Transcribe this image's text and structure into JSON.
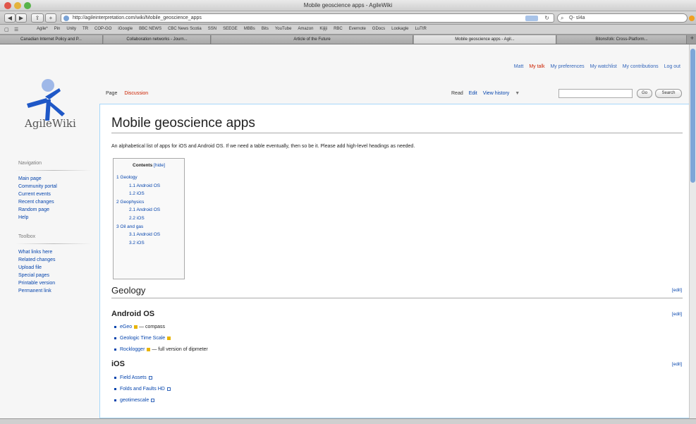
{
  "window": {
    "title": "Mobile geoscience apps - AgileWiki"
  },
  "toolbar": {
    "back": "◀",
    "forward": "▶",
    "add": "+",
    "url": "http://agileinterpretation.com/wiki/Mobile_geoscience_apps",
    "search_value": "Q- sl4a"
  },
  "bookmarks": [
    "Agile*",
    "Pin",
    "Unity",
    "TR",
    "COP-GO",
    "iGoogle",
    "BBC NEWS",
    "CBC News Scotia",
    "SSN",
    "SEEGE",
    "MBBs",
    "Bits",
    "YouTube",
    "Amazon",
    "Kijiji",
    "RBC",
    "Evernote",
    "GDocs",
    "Lookagle",
    "LuTtR"
  ],
  "tabs": [
    "Canadian Internet Policy and P...",
    "Collaboration networks - Journ...",
    "Article of the Future",
    "Mobile geoscience apps - Agil...",
    "Bitonsfolk: Cross-Platform..."
  ],
  "personal": {
    "user": "Matt",
    "talk": "My talk",
    "prefs": "My preferences",
    "watchlist": "My watchlist",
    "contribs": "My contributions",
    "logout": "Log out"
  },
  "logo_text": "AgileWiki",
  "nav": {
    "heading": "Navigation",
    "items": [
      "Main page",
      "Community portal",
      "Current events",
      "Recent changes",
      "Random page",
      "Help"
    ]
  },
  "toolbox": {
    "heading": "Toolbox",
    "items": [
      "What links here",
      "Related changes",
      "Upload file",
      "Special pages",
      "Printable version",
      "Permanent link"
    ]
  },
  "page_tabs": {
    "page": "Page",
    "discussion": "Discussion"
  },
  "view_tabs": {
    "read": "Read",
    "edit": "Edit",
    "history": "View history",
    "more": "▼"
  },
  "search": {
    "go": "Go",
    "search": "Search"
  },
  "article": {
    "title": "Mobile geoscience apps",
    "intro": "An alphabetical list of apps for iOS and Android OS. If we need a table eventually, then so be it. Please add high-level headings as needed.",
    "toc": {
      "title": "Contents",
      "hide": "[hide]",
      "items": [
        "1 Geology",
        "1.1 Android OS",
        "1.2 iOS",
        "2 Geophysics",
        "2.1 Android OS",
        "2.2 iOS",
        "3 Oil and gas",
        "3.1 Android OS",
        "3.2 iOS"
      ]
    },
    "edit": "[edit]",
    "sections": {
      "geology": "Geology",
      "android": "Android OS",
      "ios": "iOS"
    },
    "android_items": [
      {
        "name": "eGeo",
        "desc": " — compass"
      },
      {
        "name": "Geologic Time Scale",
        "desc": ""
      },
      {
        "name": "Rocklogger",
        "desc": " — full version of dipmeter"
      }
    ],
    "ios_items": [
      "Field Assets",
      "Folds and Faults HD",
      "geotimescale"
    ]
  },
  "colors": {
    "link": "#0645ad",
    "redlink": "#cc2200",
    "border": "#a7d7f9"
  }
}
